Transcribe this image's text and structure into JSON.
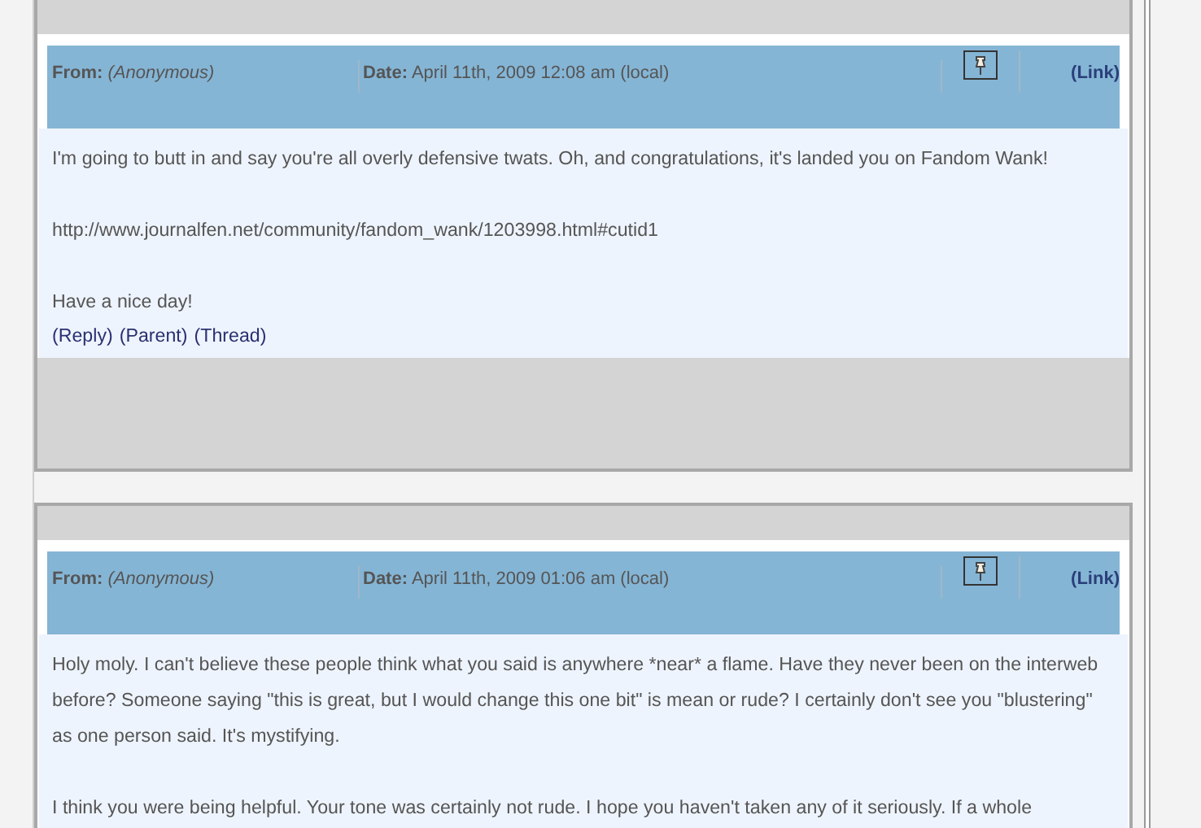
{
  "comments": [
    {
      "from_label": "From:",
      "from": "(Anonymous)",
      "date_label": "Date:",
      "date": "April 11th, 2009 12:08 am (local)",
      "link": "(Link)",
      "paragraphs": [
        "I'm going to butt in and say you're all overly defensive twats. Oh, and congratulations, it's landed you on Fandom Wank!",
        "http://www.journalfen.net/community/fandom_wank/1203998.html#cutid1",
        "Have a nice day!"
      ],
      "actions": [
        "(Reply)",
        "(Parent)",
        "(Thread)"
      ]
    },
    {
      "from_label": "From:",
      "from": "(Anonymous)",
      "date_label": "Date:",
      "date": "April 11th, 2009 01:06 am (local)",
      "link": "(Link)",
      "paragraphs": [
        "Holy moly. I can't believe these people think what you said is anywhere *near* a flame. Have they never been on the interweb before? Someone saying \"this is great, but I would change this one bit\" is mean or rude? I certainly don't see you \"blustering\" as one person said. It's mystifying.",
        "I think you were being helpful. Your tone was certainly not rude. I hope you haven't taken any of it seriously. If a whole"
      ]
    }
  ]
}
